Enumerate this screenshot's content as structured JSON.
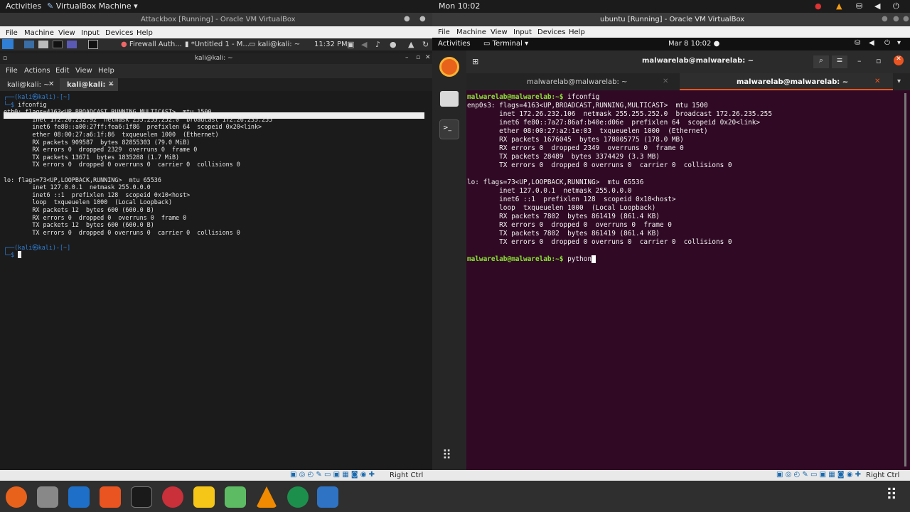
{
  "host_bar": {
    "activities": "Activities",
    "app": "VirtualBox Machine",
    "clock": "Mon 10:02"
  },
  "left_vm": {
    "title": "Attackbox [Running] - Oracle VM VirtualBox",
    "menu": [
      "File",
      "Machine",
      "View",
      "Input",
      "Devices",
      "Help"
    ],
    "kali_tasks": [
      "Firewall Auth...",
      "*Untitled 1 - M...",
      "kali@kali: ~"
    ],
    "kali_clock": "11:32 PM",
    "term_title": "kali@kali: ~",
    "term_menu": [
      "File",
      "Actions",
      "Edit",
      "View",
      "Help"
    ],
    "tabs": [
      "kali@kali: ~",
      "kali@kali: ~"
    ],
    "prompt_user": "(kali㉿kali)-[~]",
    "command": "ifconfig",
    "output": [
      "eth0: flags=4163<UP,BROADCAST,RUNNING,MULTICAST>  mtu 1500",
      "        inet 172.26.232.92  netmask 255.255.252.0  broadcast 172.26.235.255",
      "        inet6 fe80::a00:27ff:fea6:1f86  prefixlen 64  scopeid 0x20<link>",
      "        ether 08:00:27:a6:1f:86  txqueuelen 1000  (Ethernet)",
      "        RX packets 909587  bytes 82855303 (79.0 MiB)",
      "        RX errors 0  dropped 2329  overruns 0  frame 0",
      "        TX packets 13671  bytes 1835288 (1.7 MiB)",
      "        TX errors 0  dropped 0 overruns 0  carrier 0  collisions 0",
      "",
      "lo: flags=73<UP,LOOPBACK,RUNNING>  mtu 65536",
      "        inet 127.0.0.1  netmask 255.0.0.0",
      "        inet6 ::1  prefixlen 128  scopeid 0x10<host>",
      "        loop  txqueuelen 1000  (Local Loopback)",
      "        RX packets 12  bytes 600 (600.0 B)",
      "        RX errors 0  dropped 0  overruns 0  frame 0",
      "        TX packets 12  bytes 600 (600.0 B)",
      "        TX errors 0  dropped 0 overruns 0  carrier 0  collisions 0"
    ],
    "status_right_ctrl": "Right Ctrl"
  },
  "right_vm": {
    "title": "ubuntu [Running] - Oracle VM VirtualBox",
    "menu": [
      "File",
      "Machine",
      "View",
      "Input",
      "Devices",
      "Help"
    ],
    "ub_activities": "Activities",
    "ub_app": "Terminal",
    "ub_clock": "Mar 8 10:02",
    "term_title": "malwarelab@malwarelab: ~",
    "tabs": [
      "malwarelab@malwarelab: ~",
      "malwarelab@malwarelab: ~"
    ],
    "prompt": "malwarelab@malwarelab:~$",
    "command": "ifconfig",
    "output": [
      "enp0s3: flags=4163<UP,BROADCAST,RUNNING,MULTICAST>  mtu 1500",
      "        inet 172.26.232.106  netmask 255.255.252.0  broadcast 172.26.235.255",
      "        inet6 fe80::7a27:86af:b40e:d06e  prefixlen 64  scopeid 0x20<link>",
      "        ether 08:00:27:a2:1e:03  txqueuelen 1000  (Ethernet)",
      "        RX packets 1676045  bytes 178005775 (178.0 MB)",
      "        RX errors 0  dropped 2349  overruns 0  frame 0",
      "        TX packets 28489  bytes 3374429 (3.3 MB)",
      "        TX errors 0  dropped 0 overruns 0  carrier 0  collisions 0",
      "",
      "lo: flags=73<UP,LOOPBACK,RUNNING>  mtu 65536",
      "        inet 127.0.0.1  netmask 255.0.0.0",
      "        inet6 ::1  prefixlen 128  scopeid 0x10<host>",
      "        loop  txqueuelen 1000  (Local Loopback)",
      "        RX packets 7802  bytes 861419 (861.4 KB)",
      "        RX errors 0  dropped 0  overruns 0  frame 0",
      "        TX packets 7802  bytes 861419 (861.4 KB)",
      "        TX errors 0  dropped 0 overruns 0  carrier 0  collisions 0"
    ],
    "typed": "python",
    "status_right_ctrl": "Right Ctrl"
  }
}
